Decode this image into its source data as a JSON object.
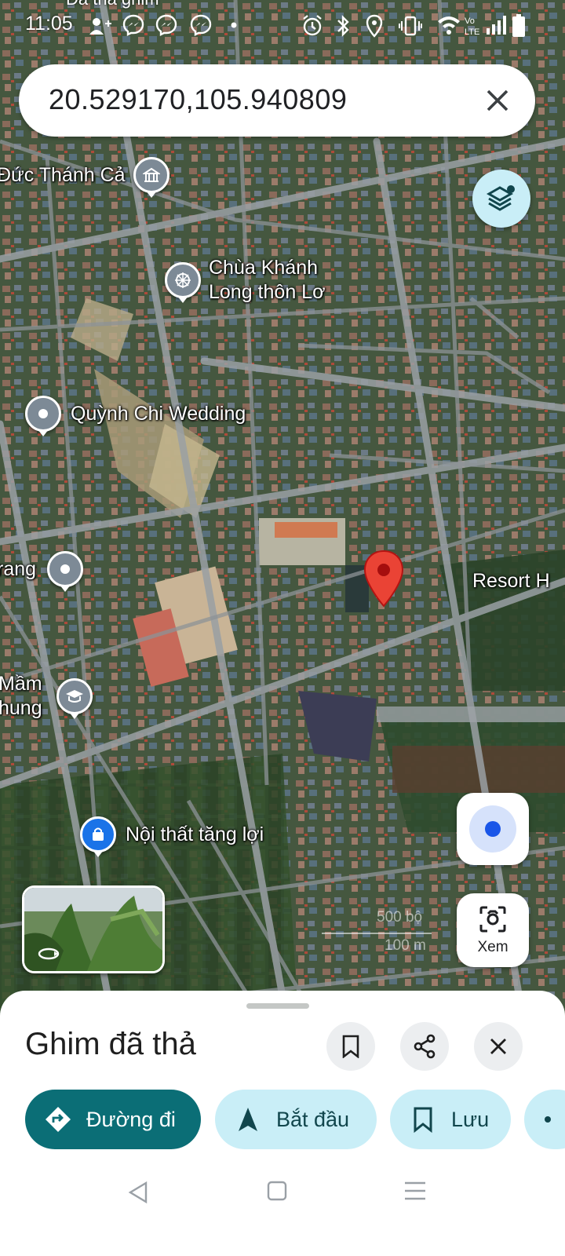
{
  "status_bar": {
    "time": "11:05",
    "notification_text": "Đã thả ghim"
  },
  "search": {
    "value": "20.529170,105.940809"
  },
  "map": {
    "pois": [
      {
        "label": "Đức Thánh Cả",
        "icon": "temple-icon"
      },
      {
        "label": "Chùa Khánh Long thôn Lơ",
        "icon": "dharma-wheel-icon"
      },
      {
        "label": "Quỳnh Chi Wedding",
        "icon": "place-icon"
      },
      {
        "label": "rang",
        "icon": "place-icon"
      },
      {
        "label": "Mầm hung",
        "icon": "school-icon"
      },
      {
        "label": "Nội thất tăng lợi",
        "icon": "shopping-bag-icon"
      },
      {
        "label": "Resort H",
        "icon": "none"
      }
    ],
    "scale_top": "500 bộ",
    "scale_bottom": "100 m"
  },
  "lens": {
    "label": "Xem"
  },
  "sheet": {
    "title": "Ghim đã thả",
    "chips": {
      "directions": "Đường đi",
      "start": "Bắt đầu",
      "save": "Lưu"
    }
  },
  "colors": {
    "primary_chip": "#0b6e76",
    "secondary_chip": "#c9eef7",
    "pin": "#ea4335",
    "location_dot": "#1a56e8"
  }
}
